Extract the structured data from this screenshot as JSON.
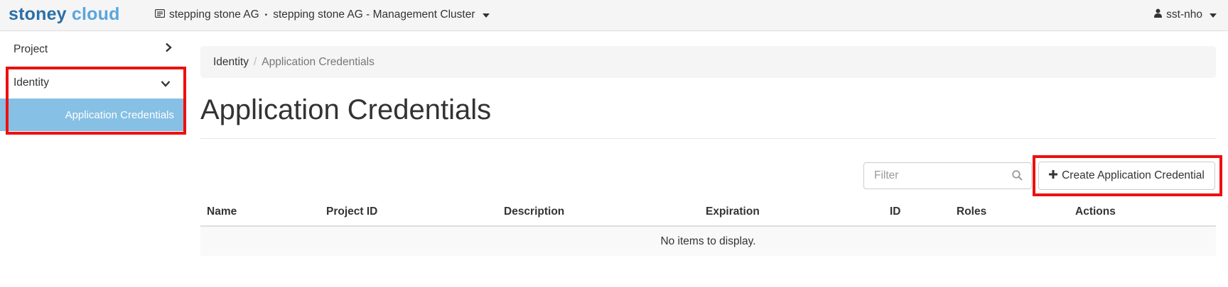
{
  "brand": {
    "part1": "stoney",
    "part2": " cloud"
  },
  "context": {
    "domain": "stepping stone AG",
    "separator": "•",
    "project": "stepping stone AG - Management Cluster"
  },
  "user": {
    "name": "sst-nho"
  },
  "sidebar": {
    "items": [
      {
        "label": "Project"
      },
      {
        "label": "Identity"
      }
    ],
    "active_sub": "Application Credentials"
  },
  "breadcrumb": {
    "root": "Identity",
    "separator": "/",
    "current": "Application Credentials"
  },
  "page": {
    "title": "Application Credentials"
  },
  "toolbar": {
    "filter_placeholder": "Filter",
    "create_label": "Create Application Credential"
  },
  "table": {
    "columns": [
      "Name",
      "Project ID",
      "Description",
      "Expiration",
      "ID",
      "Roles",
      "Actions"
    ],
    "empty_message": "No items to display."
  },
  "colors": {
    "brand_dark": "#2a6fa8",
    "brand_light": "#59a6dd",
    "active_nav": "#86c0e5",
    "highlight": "#ee0f0f"
  }
}
